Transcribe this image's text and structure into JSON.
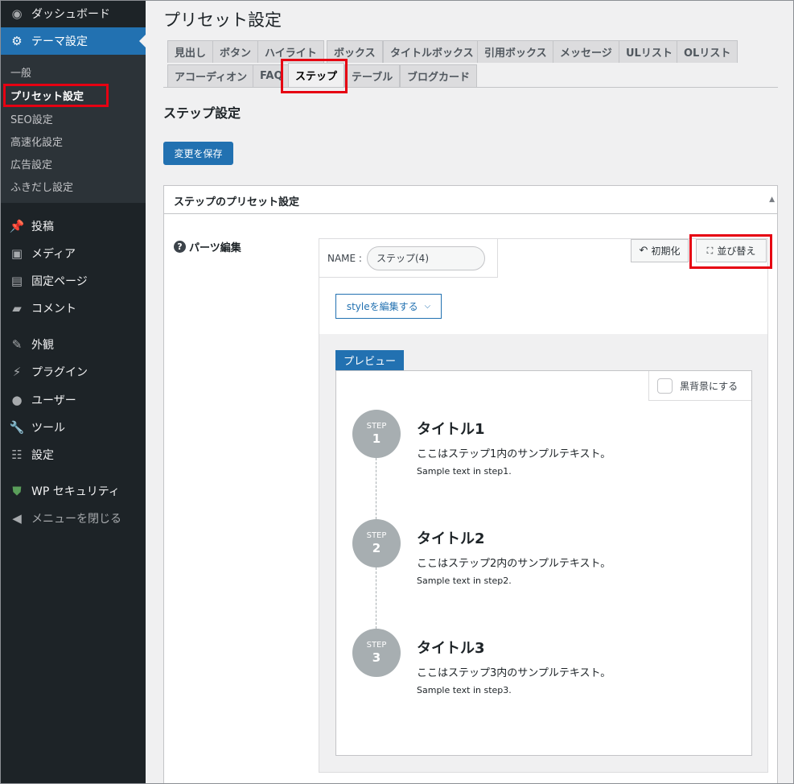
{
  "sidebar": {
    "items": [
      {
        "label": "ダッシュボード",
        "icon": "dashboard-icon"
      },
      {
        "label": "テーマ設定",
        "icon": "gear-icon"
      },
      {
        "label": "投稿",
        "icon": "pin-icon"
      },
      {
        "label": "メディア",
        "icon": "media-icon"
      },
      {
        "label": "固定ページ",
        "icon": "page-icon"
      },
      {
        "label": "コメント",
        "icon": "comment-icon"
      },
      {
        "label": "外観",
        "icon": "brush-icon"
      },
      {
        "label": "プラグイン",
        "icon": "plugin-icon"
      },
      {
        "label": "ユーザー",
        "icon": "user-icon"
      },
      {
        "label": "ツール",
        "icon": "wrench-icon"
      },
      {
        "label": "設定",
        "icon": "settings-icon"
      },
      {
        "label": "WP セキュリティ",
        "icon": "shield-icon"
      },
      {
        "label": "メニューを閉じる",
        "icon": "collapse-icon"
      }
    ],
    "submenu": [
      "一般",
      "プリセット設定",
      "SEO設定",
      "高速化設定",
      "広告設定",
      "ふきだし設定"
    ]
  },
  "header": {
    "title": "プリセット設定"
  },
  "tabs": [
    "見出し",
    "ボタン",
    "ハイライト",
    "ボックス",
    "タイトルボックス",
    "引用ボックス",
    "メッセージ",
    "ULリスト",
    "OLリスト",
    "アコーディオン",
    "FAQ",
    "ステップ",
    "テーブル",
    "ブログカード"
  ],
  "active_tab": "ステップ",
  "section_title": "ステップ設定",
  "save_label": "変更を保存",
  "panel": {
    "title": "ステップのプリセット設定",
    "parts_label": "パーツ編集",
    "name_label": "NAME :",
    "name_value": "ステップ(4)",
    "reset_label": "初期化",
    "sort_label": "並び替え",
    "style_label": "styleを編集する",
    "preview_label": "プレビュー",
    "dark_label": "黒背景にする"
  },
  "steps": [
    {
      "step_label": "STEP",
      "num": "1",
      "title": "タイトル1",
      "text": "ここはステップ1内のサンプルテキスト。",
      "text_en": "Sample text in step1."
    },
    {
      "step_label": "STEP",
      "num": "2",
      "title": "タイトル2",
      "text": "ここはステップ2内のサンプルテキスト。",
      "text_en": "Sample text in step2."
    },
    {
      "step_label": "STEP",
      "num": "3",
      "title": "タイトル3",
      "text": "ここはステップ3内のサンプルテキスト。",
      "text_en": "Sample text in step3."
    }
  ],
  "colors": {
    "accent": "#2271b1",
    "sidebar_bg": "#1d2327",
    "highlight": "#e60012",
    "step_circle": "#a7aeb1"
  }
}
